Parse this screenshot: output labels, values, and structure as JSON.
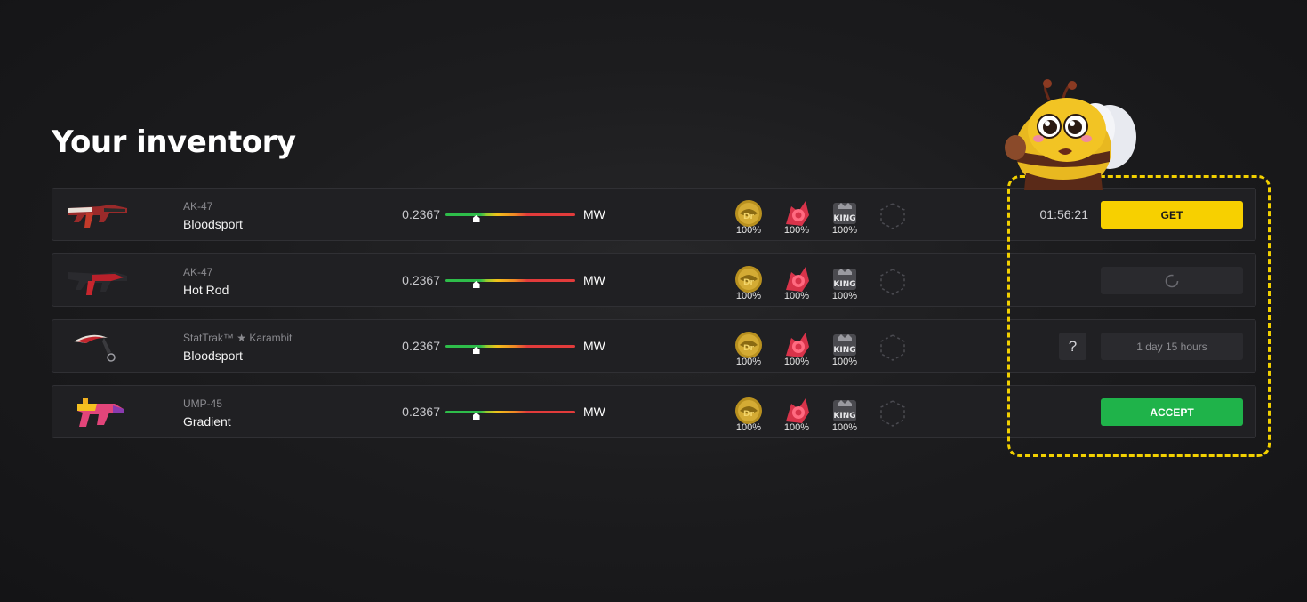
{
  "page": {
    "title": "Your inventory"
  },
  "items": [
    {
      "type": "AK-47",
      "name": "Bloodsport",
      "float": "0.2367",
      "float_fraction": 0.2367,
      "wear": "MW",
      "stickers": [
        {
          "icon": "gold-sticker-icon",
          "percent": "100%"
        },
        {
          "icon": "red-logo-sticker-icon",
          "percent": "100%"
        },
        {
          "icon": "king-sticker-icon",
          "percent": "100%"
        }
      ],
      "timer": "01:56:21",
      "action_label": "GET"
    },
    {
      "type": "AK-47",
      "name": "Hot Rod",
      "float": "0.2367",
      "float_fraction": 0.2367,
      "wear": "MW",
      "stickers": [
        {
          "icon": "gold-sticker-icon",
          "percent": "100%"
        },
        {
          "icon": "red-logo-sticker-icon",
          "percent": "100%"
        },
        {
          "icon": "king-sticker-icon",
          "percent": "100%"
        }
      ],
      "action_label": ""
    },
    {
      "type": "StatTrak™ ★ Karambit",
      "name": "Bloodsport",
      "float": "0.2367",
      "float_fraction": 0.2367,
      "wear": "MW",
      "stickers": [
        {
          "icon": "gold-sticker-icon",
          "percent": "100%"
        },
        {
          "icon": "red-logo-sticker-icon",
          "percent": "100%"
        },
        {
          "icon": "king-sticker-icon",
          "percent": "100%"
        }
      ],
      "help_label": "?",
      "action_label": "1 day 15 hours"
    },
    {
      "type": "UMP-45",
      "name": "Gradient",
      "float": "0.2367",
      "float_fraction": 0.2367,
      "wear": "MW",
      "stickers": [
        {
          "icon": "gold-sticker-icon",
          "percent": "100%"
        },
        {
          "icon": "red-logo-sticker-icon",
          "percent": "100%"
        },
        {
          "icon": "king-sticker-icon",
          "percent": "100%"
        }
      ],
      "action_label": "ACCEPT"
    }
  ],
  "colors": {
    "get": "#f7d000",
    "accept": "#1fb34a",
    "highlight": "#f2d000"
  }
}
